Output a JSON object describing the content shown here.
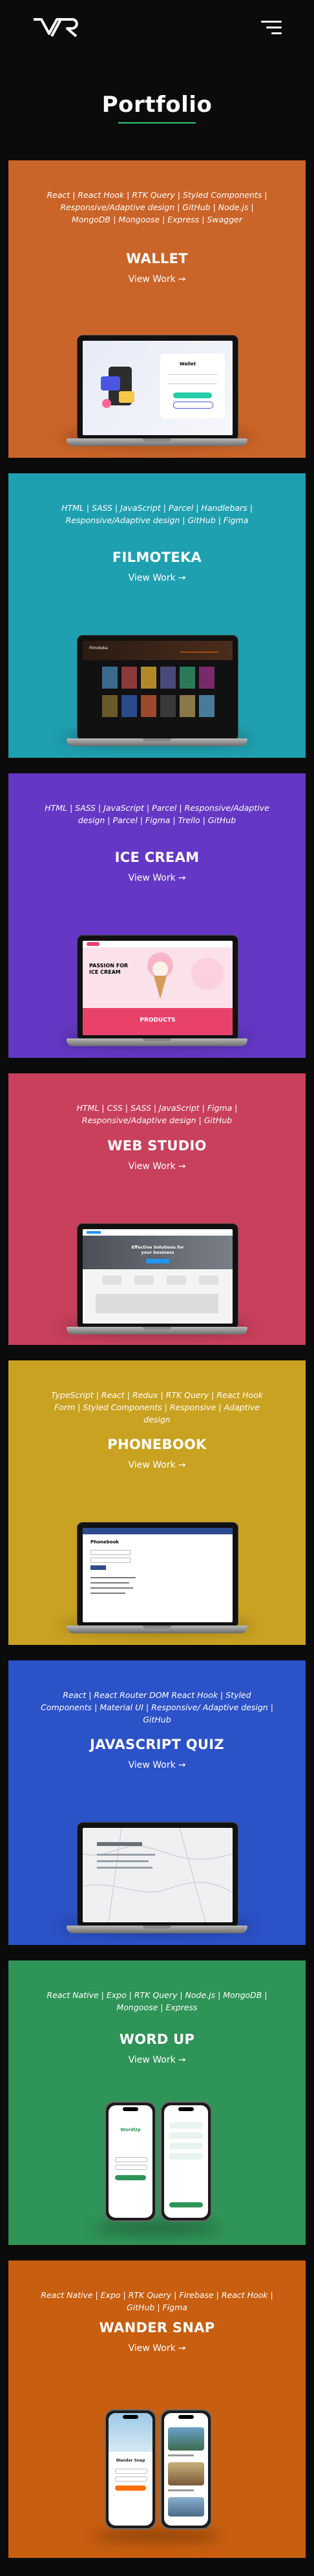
{
  "header": {
    "logo_text": "VR",
    "menu_icon": "hamburger-menu-icon"
  },
  "page_title": "Portfolio",
  "colors": {
    "background": "#0b0b0b",
    "accent_underline": "#2ecc71"
  },
  "projects": [
    {
      "tags": "React | React Hook | RTK Query | Styled Components | Responsive/Adaptive design | GitHub | Node.js | MongoDB | Mongoose | Express | Swagger",
      "name": "WALLET",
      "view_label": "View Work",
      "color": "#cb6428"
    },
    {
      "tags": "HTML | SASS | JavaScript | Parcel | Handlebars | Responsive/Adaptive design | GitHub | Figma",
      "name": "FILMOTEKA",
      "view_label": "View Work",
      "color": "#1fa0b0"
    },
    {
      "tags": "HTML | SASS | JavaScript | Parcel | Responsive/Adaptive design | Parcel | Figma | Trello | GitHub",
      "name": "ICE CREAM",
      "view_label": "View Work",
      "color": "#6438c4"
    },
    {
      "tags": "HTML | CSS | SASS | JavaScript | Figma | Responsive/Adaptive design | GitHub",
      "name": "WEB STUDIO",
      "view_label": "View Work",
      "color": "#c8405c"
    },
    {
      "tags": "TypeScript | React | Redux | RTK Query | React Hook Form | Styled Components | Responsive | Adaptive design",
      "name": "PHONEBOOK",
      "view_label": "View Work",
      "color": "#caa222"
    },
    {
      "tags": "React | React Router DOM React Hook | Styled Components | Material UI | Responsive/ Adaptive design | GitHub",
      "name": "JAVASCRIPT QUIZ",
      "view_label": "View Work",
      "color": "#2c52c8"
    },
    {
      "tags": "React Native | Expo | RTK Query | Node.js | MongoDB | Mongoose | Express",
      "name": "WORD UP",
      "view_label": "View Work",
      "color": "#2f9458"
    },
    {
      "tags": "React Native | Expo | RTK Query | Firebase | React Hook | GitHub | Figma",
      "name": "WANDER SNAP",
      "view_label": "View Work",
      "color": "#c85e0f"
    }
  ],
  "mockups": {
    "wallet": {
      "brand": "Wallet"
    },
    "filmoteka": {
      "brand": "Filmoteka"
    },
    "icecream": {
      "headline": "PASSION FOR ICE CREAM",
      "section": "PRODUCTS"
    },
    "webstudio": {
      "headline": "Effective Solutions for your business"
    },
    "phonebook": {
      "heading": "Phonebook"
    },
    "wordup": {
      "heading": "WordUp"
    },
    "wander": {
      "heading": "Wander Snap"
    }
  }
}
